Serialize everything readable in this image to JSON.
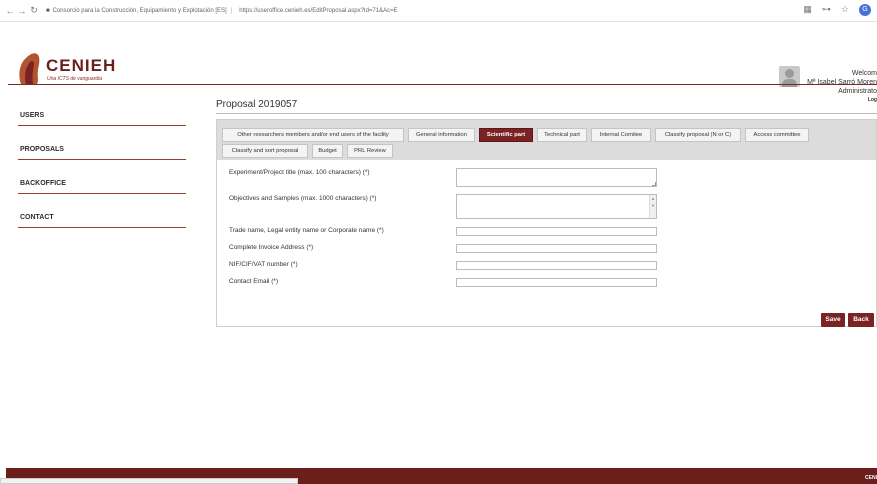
{
  "browser": {
    "url_site": "Consorcio para la Construcción, Equipamiento y Explotación [ES]",
    "url_path": "https://useroffice.cenieh.es/EditProposal.aspx?Id=71&Ac=E",
    "profile_initial": "G"
  },
  "logo": {
    "name": "CENIEH",
    "tagline": "Una ICTS de vanguardia"
  },
  "user": {
    "welcome": "Welcom",
    "name": "Mª Isabel Sarró Moren",
    "role": "Administrato",
    "logout": "Log"
  },
  "sidebar": {
    "items": [
      {
        "label": "USERS"
      },
      {
        "label": "PROPOSALS"
      },
      {
        "label": "BACKOFFICE"
      },
      {
        "label": "CONTACT"
      }
    ]
  },
  "page": {
    "title": "Proposal 2019057"
  },
  "tabs": [
    {
      "label": "Other researchers members and/or end users of the facility"
    },
    {
      "label": "General information"
    },
    {
      "label": "Scientific part"
    },
    {
      "label": "Technical part"
    },
    {
      "label": "Internal Comitee"
    },
    {
      "label": "Classify proposal (N or C)"
    },
    {
      "label": "Access committee"
    },
    {
      "label": "Classify and sort proposal"
    },
    {
      "label": "Budget"
    },
    {
      "label": "PRL Review"
    }
  ],
  "form": {
    "fields": [
      {
        "label": "Experiment/Project title (max. 100 characters) (*)",
        "value": ""
      },
      {
        "label": "Objectives and Samples (max. 1000 characters) (*)",
        "value": ""
      },
      {
        "label": "Trade name, Legal entity name or Corporate name (*)",
        "value": ""
      },
      {
        "label": "Complete Invoice Address (*)",
        "value": ""
      },
      {
        "label": "NIF/CIF/VAT number (*)",
        "value": ""
      },
      {
        "label": "Contact Email (*)",
        "value": ""
      }
    ]
  },
  "buttons": {
    "save": "Save",
    "back": "Back"
  },
  "footer": {
    "text": "CENI"
  },
  "colors": {
    "brand": "#7a2224",
    "header_line": "#7a2c24",
    "footer": "#6b1f1a"
  }
}
